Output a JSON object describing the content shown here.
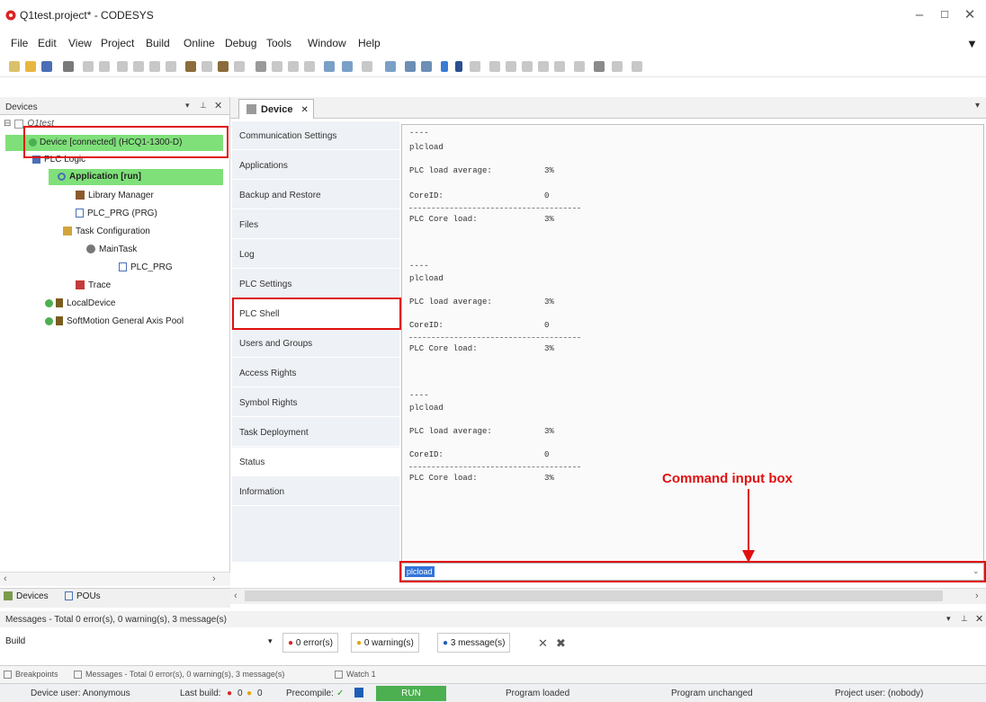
{
  "window": {
    "title": "Q1test.project* - CODESYS"
  },
  "menu": [
    "File",
    "Edit",
    "View",
    "Project",
    "Build",
    "Online",
    "Debug",
    "Tools",
    "Window",
    "Help"
  ],
  "devices_panel": {
    "header": "Devices",
    "tree": {
      "project": "Q1test",
      "device": "Device [connected] (HCQ1-1300-D)",
      "plc_logic": "PLC Logic",
      "application": "Application [run]",
      "library_manager": "Library Manager",
      "plc_prg": "PLC_PRG (PRG)",
      "task_config": "Task Configuration",
      "main_task": "MainTask",
      "task_plc_prg": "PLC_PRG",
      "trace": "Trace",
      "local_device": "LocalDevice",
      "softmotion": "SoftMotion General Axis Pool"
    },
    "tabs": [
      "Devices",
      "POUs"
    ]
  },
  "editor": {
    "tab": "Device"
  },
  "sidenav": [
    "Communication Settings",
    "Applications",
    "Backup and Restore",
    "Files",
    "Log",
    "PLC Settings",
    "PLC Shell",
    "Users and Groups",
    "Access Rights",
    "Symbol Rights",
    "Task Deployment",
    "Status",
    "Information"
  ],
  "shell": {
    "block_sep": "----",
    "cmd": "plcload",
    "load_label": "PLC load average:",
    "load_value": "3%",
    "core_label": "CoreID:",
    "core_value": "0",
    "coreload_label": "PLC Core load:",
    "coreload_value": "3%"
  },
  "command_input": {
    "value": "plcload"
  },
  "annotation": {
    "text": "Command input box"
  },
  "messages": {
    "header": "Messages - Total 0 error(s), 0 warning(s), 3 message(s)",
    "filter": "Build",
    "errors": "0 error(s)",
    "warnings": "0 warning(s)",
    "messages": "3 message(s)"
  },
  "bottom_tabs": [
    "Breakpoints",
    "Messages - Total 0 error(s), 0 warning(s), 3 message(s)",
    "Watch 1"
  ],
  "status": {
    "device_user": "Device user: Anonymous",
    "last_build": "Last build:",
    "err_count": "0",
    "warn_count": "0",
    "precompile": "Precompile:",
    "run": "RUN",
    "program_loaded": "Program loaded",
    "program_unchanged": "Program unchanged",
    "project_user": "Project user: (nobody)"
  },
  "colors": {
    "accent_green": "#4caf50",
    "highlight_red": "#e01010",
    "selection_blue": "#3274d9"
  }
}
